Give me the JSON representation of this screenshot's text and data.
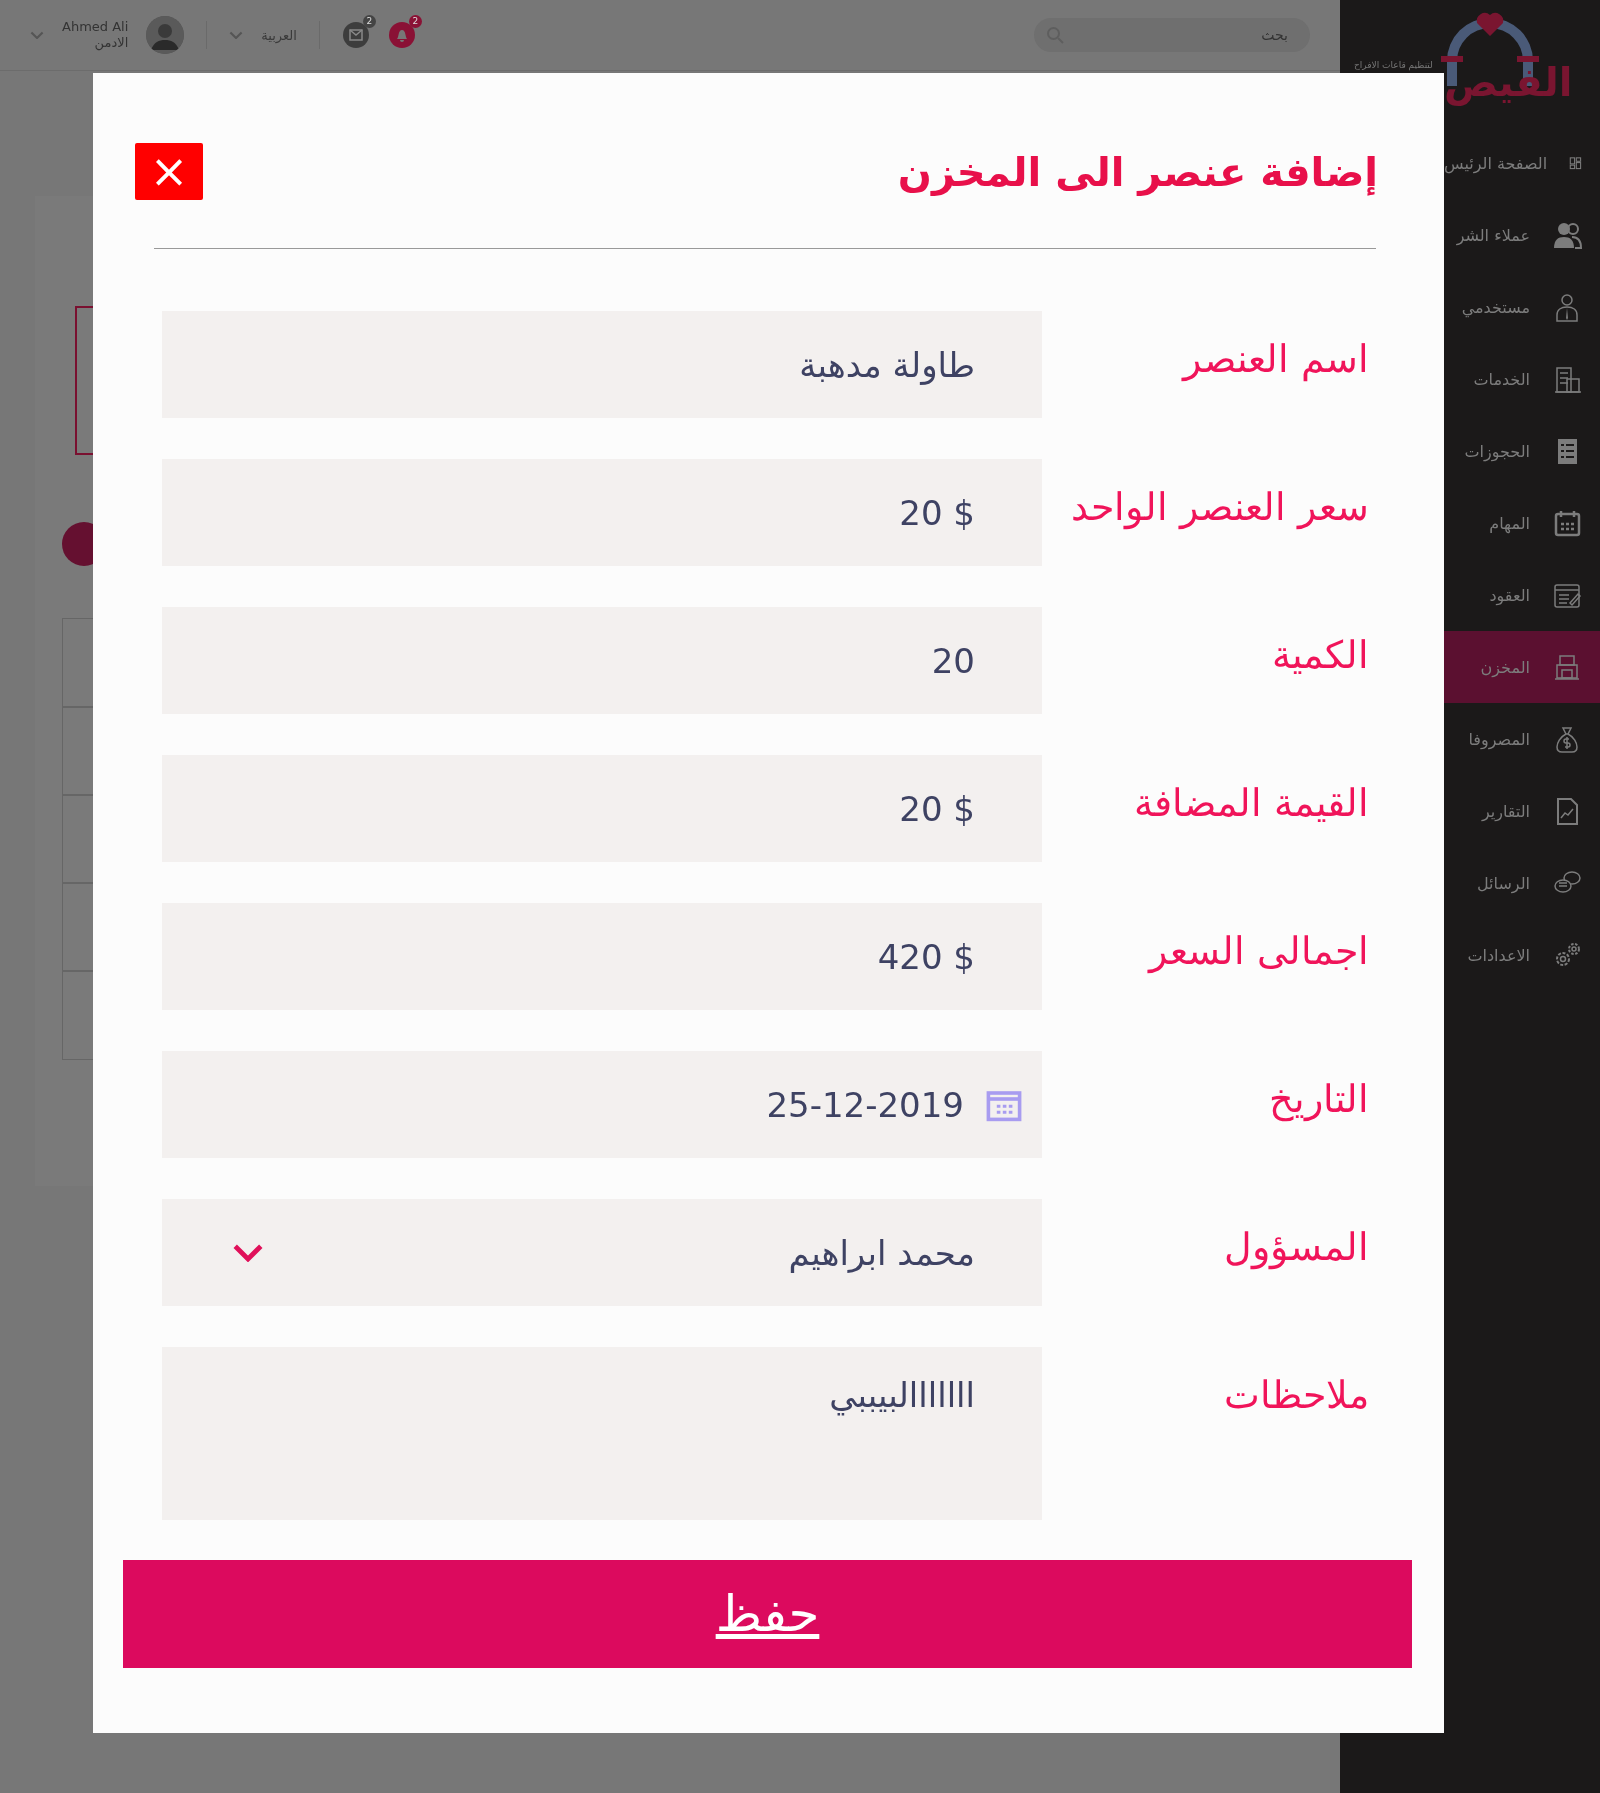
{
  "top_bar": {
    "user": {
      "name": "Ahmed Ali",
      "role": "الادمن"
    },
    "language": "العربية",
    "messages_badge": "2",
    "notifications_badge": "2",
    "search": {
      "placeholder": "بحث"
    }
  },
  "logo": {
    "name": "الفيص",
    "tagline": "لتنظيم قاعات الافراح"
  },
  "sidebar": {
    "items": [
      {
        "label": "الصفحة الرئيس",
        "selected": false
      },
      {
        "label": "عملاء الشر",
        "selected": false
      },
      {
        "label": "مستخدمي",
        "selected": false
      },
      {
        "label": "الخدمات",
        "selected": false
      },
      {
        "label": "الحجوزات",
        "selected": false
      },
      {
        "label": "المهام",
        "selected": false
      },
      {
        "label": "العقود",
        "selected": false
      },
      {
        "label": "المخزن",
        "selected": true
      },
      {
        "label": "المصروفا",
        "selected": false
      },
      {
        "label": "التقارير",
        "selected": false
      },
      {
        "label": "الرسائل",
        "selected": false
      },
      {
        "label": "الاعدادات",
        "selected": false
      }
    ]
  },
  "dialog": {
    "title": "إضافة عنصر الى المخزن",
    "close": "×",
    "fields": [
      {
        "kind": "text",
        "label": "اسم العنصر",
        "value": "طاولة مدهبة"
      },
      {
        "kind": "text",
        "label": "سعر العنصر الواحد",
        "value": "20 $"
      },
      {
        "kind": "text",
        "label": "الكمية",
        "value": "20"
      },
      {
        "kind": "text",
        "label": "القيمة المضافة",
        "value": "20 $"
      },
      {
        "kind": "text",
        "label": "اجمالى السعر",
        "value": "420 $"
      },
      {
        "kind": "date",
        "label": "التاريخ",
        "value": "25-12-2019"
      },
      {
        "kind": "select",
        "label": "المسؤول",
        "value": "محمد ابراهيم"
      },
      {
        "kind": "textarea",
        "label": "ملاحظات",
        "value": "ااااااالبيببي"
      }
    ],
    "save_button": "حفظ"
  }
}
